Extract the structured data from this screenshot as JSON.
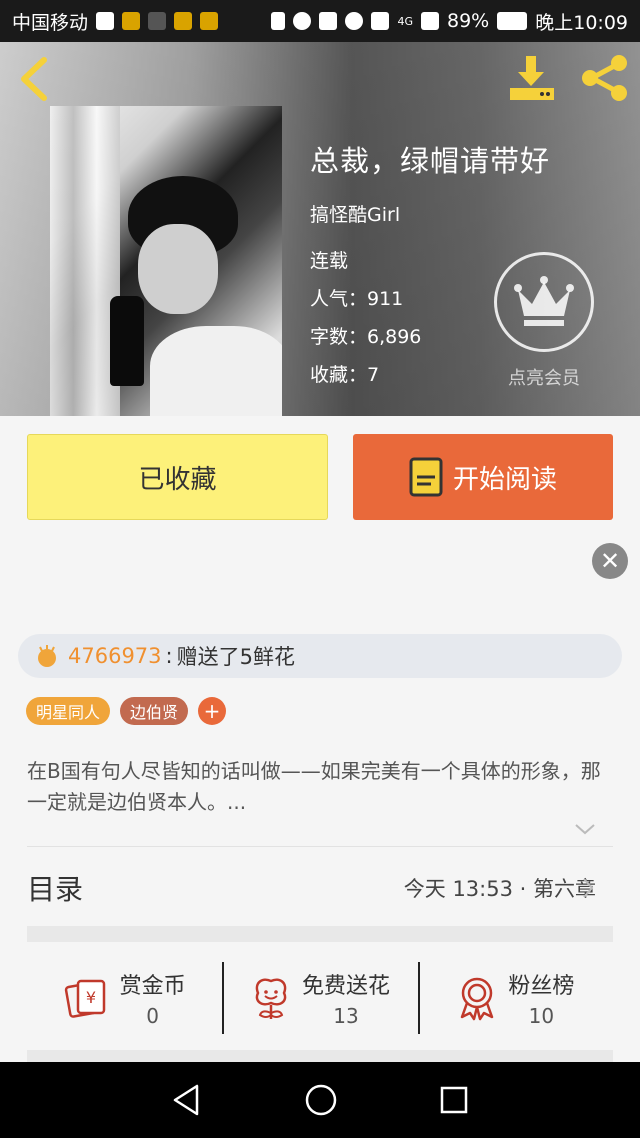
{
  "status_bar": {
    "carrier": "中国移动",
    "battery": "89%",
    "time": "晚上10:09",
    "network": "4G"
  },
  "book": {
    "title": "总裁，绿帽请带好",
    "author": "搞怪酷Girl",
    "status": "连载",
    "popularity": "人气：911",
    "word_count": "字数：6,896",
    "favorites": "收藏：7"
  },
  "vip": {
    "label": "点亮会员"
  },
  "actions": {
    "collected_label": "已收藏",
    "read_label": "开始阅读"
  },
  "gift_bar": {
    "user_id": "4766973",
    "separator": ":",
    "message": "赠送了5鲜花"
  },
  "tags": [
    {
      "label": "明星同人"
    },
    {
      "label": "边伯贤"
    },
    {
      "label": "+"
    }
  ],
  "description": "在B国有句人尽皆知的话叫做——如果完美有一个具体的形象，那一定就是边伯贤本人。...",
  "toc": {
    "title": "目录",
    "latest": "今天 13:53 · 第六章"
  },
  "stats": [
    {
      "label": "赏金币",
      "value": "0",
      "icon": "reward-coin-icon"
    },
    {
      "label": "免费送花",
      "value": "13",
      "icon": "flower-icon"
    },
    {
      "label": "粉丝榜",
      "value": "10",
      "icon": "medal-icon"
    }
  ],
  "colors": {
    "accent_orange": "#e9693a",
    "collected_yellow": "#fdf17a",
    "header_icon_yellow": "#f5d13a",
    "user_orange": "#f0902f"
  }
}
